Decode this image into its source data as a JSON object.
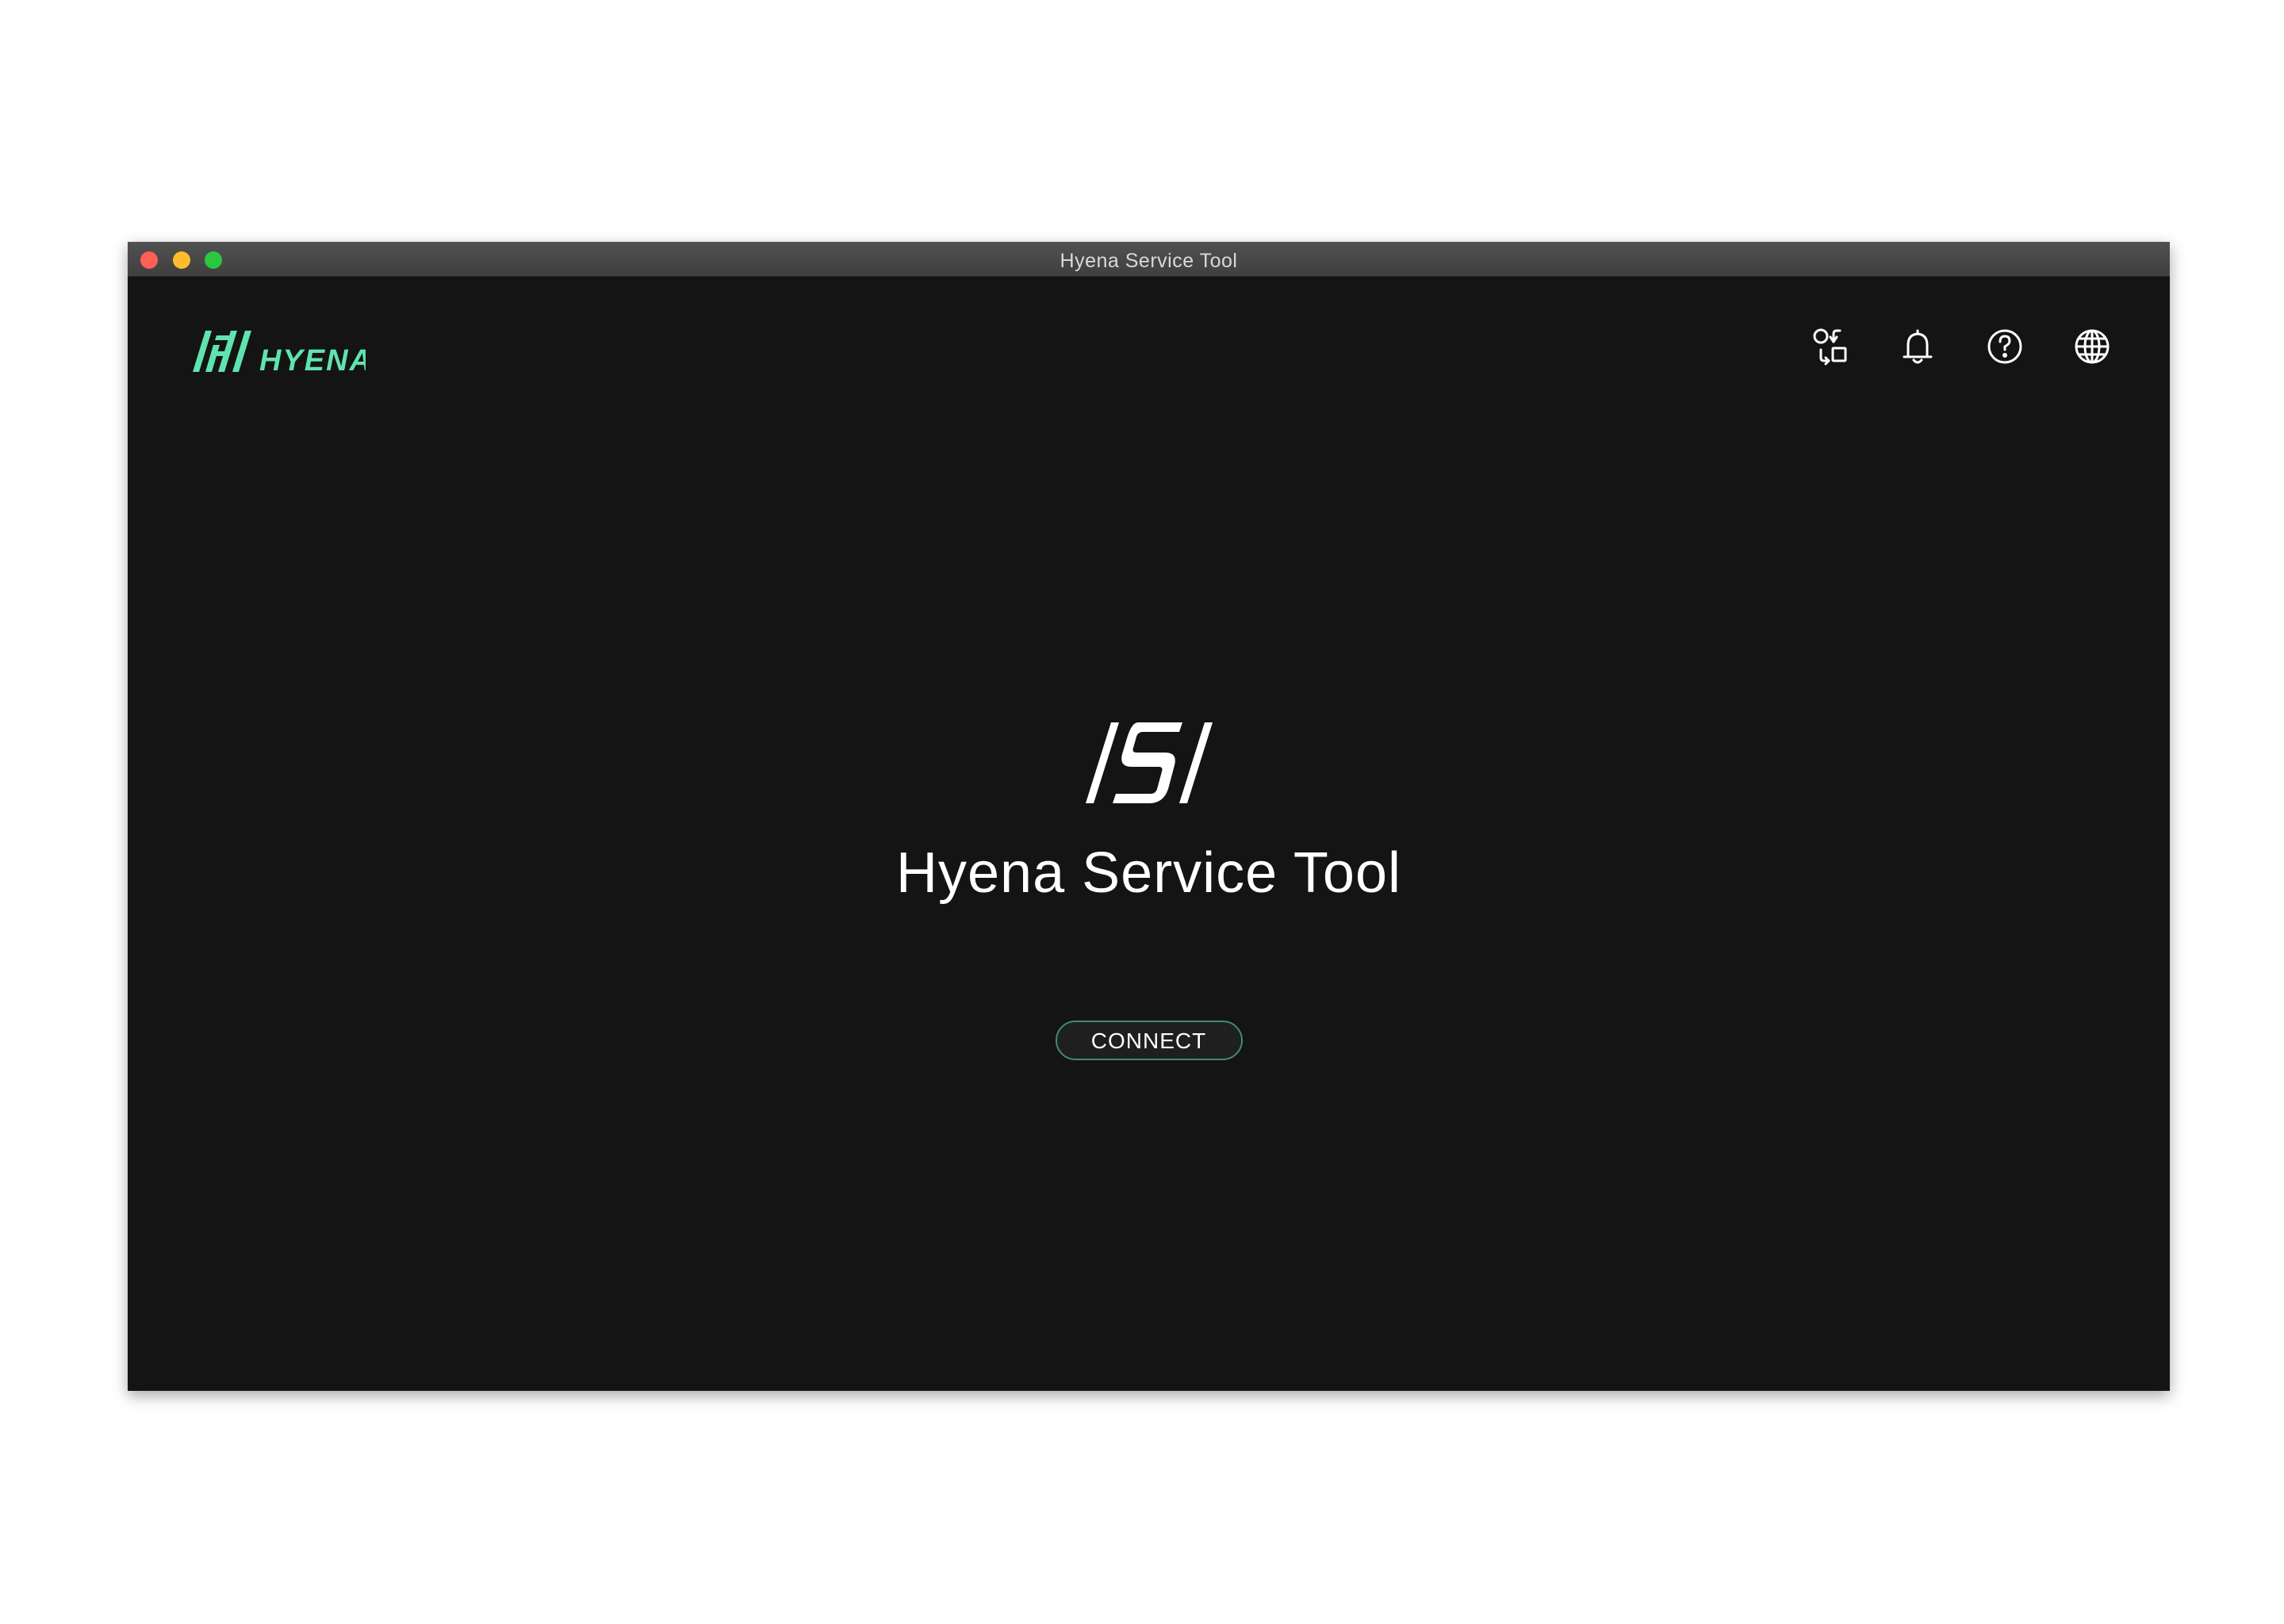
{
  "window": {
    "title": "Hyena Service Tool",
    "controls": {
      "close_color": "#ff5f57",
      "minimize_color": "#febc2e",
      "maximize_color": "#28c840"
    }
  },
  "brand": {
    "logo_text": "HYENA",
    "logo_mark": "/H/",
    "accent_color": "#5fe3b0"
  },
  "toolbar": {
    "items": [
      {
        "icon": "switch-shapes-icon",
        "label": ""
      },
      {
        "icon": "bell-icon",
        "label": ""
      },
      {
        "icon": "help-icon",
        "label": ""
      },
      {
        "icon": "globe-icon",
        "label": ""
      }
    ]
  },
  "main": {
    "app_mark": "/S/",
    "app_title": "Hyena Service Tool",
    "connect_label": "CONNECT",
    "connect_border_color": "#3d8f6a"
  }
}
